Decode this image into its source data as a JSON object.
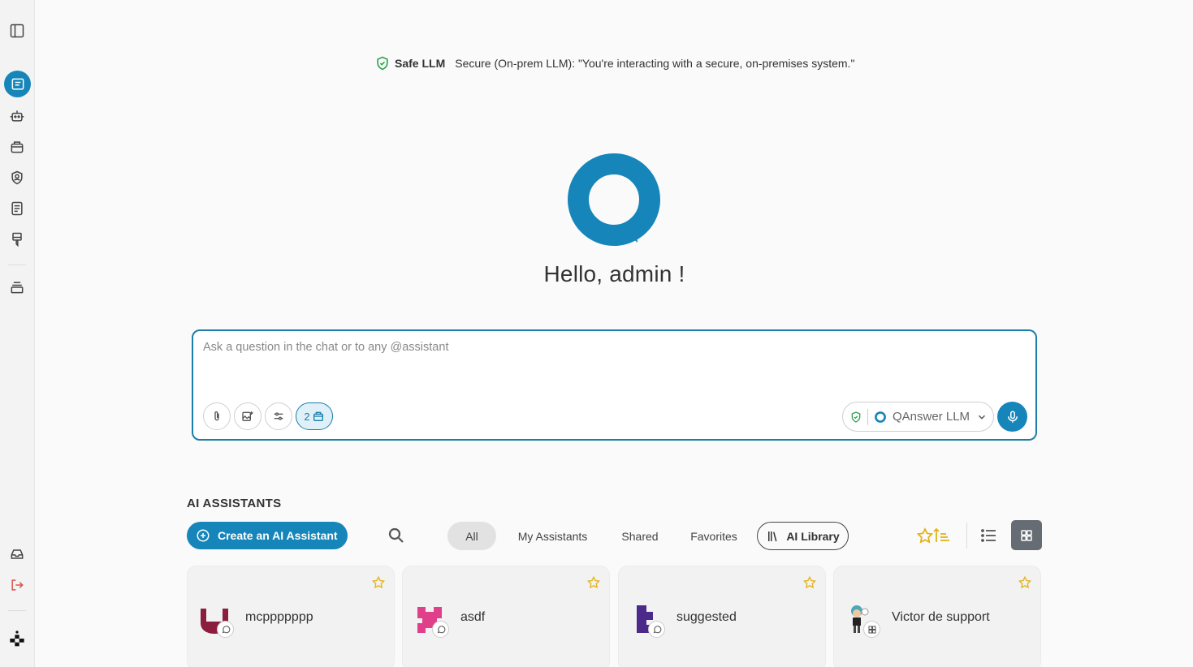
{
  "sidebar": {
    "icons": [
      "sidebar-toggle-icon",
      "chat-icon",
      "robot-icon",
      "briefcase-icon",
      "shield-user-icon",
      "document-icon",
      "brush-icon",
      "stack-icon",
      "inbox-icon",
      "logout-icon",
      "app-logo-icon"
    ]
  },
  "banner": {
    "title": "Safe LLM",
    "message": "Secure (On-prem LLM): \"You're interacting with a secure, on-premises system.\""
  },
  "greeting": "Hello, admin !",
  "chat": {
    "placeholder": "Ask a question in the chat or to any @assistant",
    "tool_count": "2",
    "model": "QAnswer LLM"
  },
  "assistants": {
    "section_title": "AI ASSISTANTS",
    "create_label": "Create an AI Assistant",
    "filters": [
      "All",
      "My Assistants",
      "Shared",
      "Favorites"
    ],
    "library_label": "AI Library",
    "cards": [
      {
        "name": "mcppppppp",
        "avatar_color": "#8b1e3f",
        "badge": "chat-bubble-icon"
      },
      {
        "name": "asdf",
        "avatar_color": "#e0408a",
        "badge": "chat-bubble-icon"
      },
      {
        "name": "suggested",
        "avatar_color": "#4b2a8a",
        "badge": "chat-bubble-icon"
      },
      {
        "name": "Victor de support",
        "avatar_color": "#4aa8b8",
        "badge": "grid-icon"
      }
    ]
  },
  "colors": {
    "accent": "#1685b9",
    "star": "#e3b21a",
    "safe_green": "#2ea44f"
  }
}
